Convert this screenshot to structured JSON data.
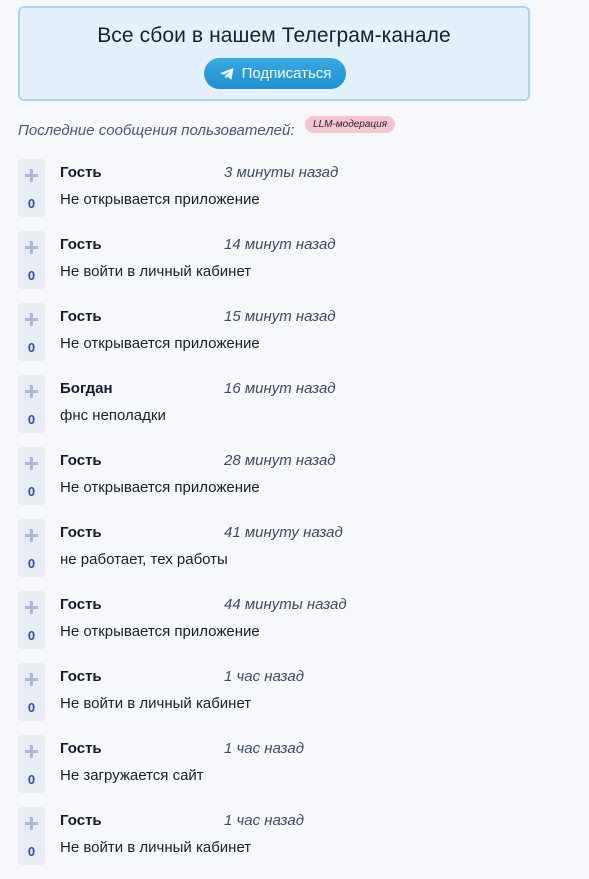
{
  "banner": {
    "title": "Все сбои в нашем Телеграм-канале",
    "subscribe_label": "Подписаться",
    "icon": "telegram-icon"
  },
  "section": {
    "caption": "Последние сообщения пользователей:",
    "badge": "LLM-модерация"
  },
  "colors": {
    "accent": "#2a9ad8",
    "banner_bg": "#e4f1fb",
    "badge_bg": "#f4c6d1",
    "vote_count": "#2b4fa8"
  },
  "messages": [
    {
      "author": "Гость",
      "time": "3 минуты назад",
      "text": "Не открывается приложение",
      "votes": "0"
    },
    {
      "author": "Гость",
      "time": "14 минут назад",
      "text": "Не войти в личный кабинет",
      "votes": "0"
    },
    {
      "author": "Гость",
      "time": "15 минут назад",
      "text": "Не открывается приложение",
      "votes": "0"
    },
    {
      "author": "Богдан",
      "time": "16 минут назад",
      "text": "фнс неполадки",
      "votes": "0"
    },
    {
      "author": "Гость",
      "time": "28 минут назад",
      "text": "Не открывается приложение",
      "votes": "0"
    },
    {
      "author": "Гость",
      "time": "41 минуту назад",
      "text": "не работает, тех работы",
      "votes": "0"
    },
    {
      "author": "Гость",
      "time": "44 минуты назад",
      "text": "Не открывается приложение",
      "votes": "0"
    },
    {
      "author": "Гость",
      "time": "1 час назад",
      "text": "Не войти в личный кабинет",
      "votes": "0"
    },
    {
      "author": "Гость",
      "time": "1 час назад",
      "text": "Не загружается сайт",
      "votes": "0"
    },
    {
      "author": "Гость",
      "time": "1 час назад",
      "text": "Не войти в личный кабинет",
      "votes": "0"
    }
  ]
}
